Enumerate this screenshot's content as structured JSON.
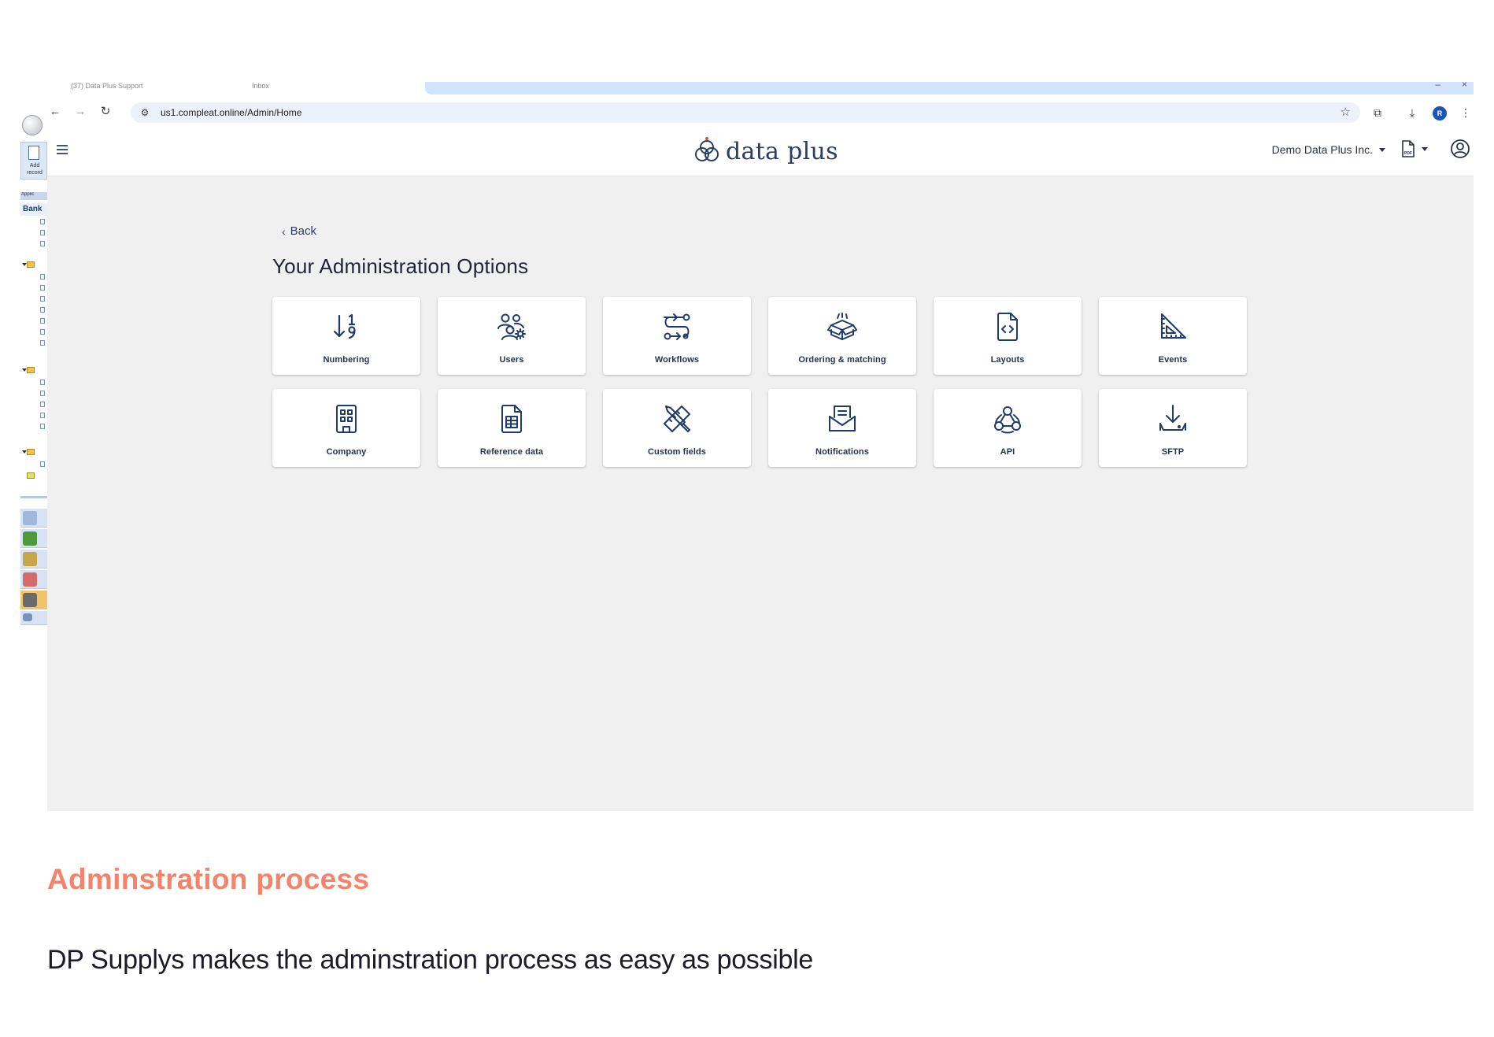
{
  "left_app": {
    "add_label_1": "Add",
    "add_label_2": "record",
    "applic_label": "Applic",
    "bank_label": "Bank"
  },
  "browser": {
    "tabs": [
      {
        "label": "(37) Data Plus Support"
      },
      {
        "label": "Inbox"
      }
    ],
    "url": "us1.compleat.online/Admin/Home",
    "profile_initial": "R"
  },
  "header": {
    "logo_text": "data plus",
    "company": "Demo Data Plus Inc.",
    "pdf_badge": "PDF"
  },
  "main": {
    "back_label": "Back",
    "title": "Your Administration Options",
    "options": [
      {
        "label": "Numbering",
        "icon": "sort-numeric-icon"
      },
      {
        "label": "Users",
        "icon": "users-gear-icon"
      },
      {
        "label": "Workflows",
        "icon": "route-icon"
      },
      {
        "label": "Ordering & matching",
        "icon": "open-box-icon"
      },
      {
        "label": "Layouts",
        "icon": "file-code-icon"
      },
      {
        "label": "Events",
        "icon": "set-square-icon"
      },
      {
        "label": "Company",
        "icon": "building-icon"
      },
      {
        "label": "Reference data",
        "icon": "file-table-icon"
      },
      {
        "label": "Custom fields",
        "icon": "pencil-ruler-icon"
      },
      {
        "label": "Notifications",
        "icon": "envelope-open-icon"
      },
      {
        "label": "API",
        "icon": "webhook-icon"
      },
      {
        "label": "SFTP",
        "icon": "download-tray-icon"
      }
    ]
  },
  "caption": {
    "title": "Adminstration process",
    "text": "DP Supplys makes the adminstration process as easy as possible"
  },
  "colors": {
    "accent_caption": "#f4836c",
    "icon_navy": "#1f3a6b",
    "content_bg": "#f0f0f0",
    "omnibox_bg": "#edf2fa"
  }
}
